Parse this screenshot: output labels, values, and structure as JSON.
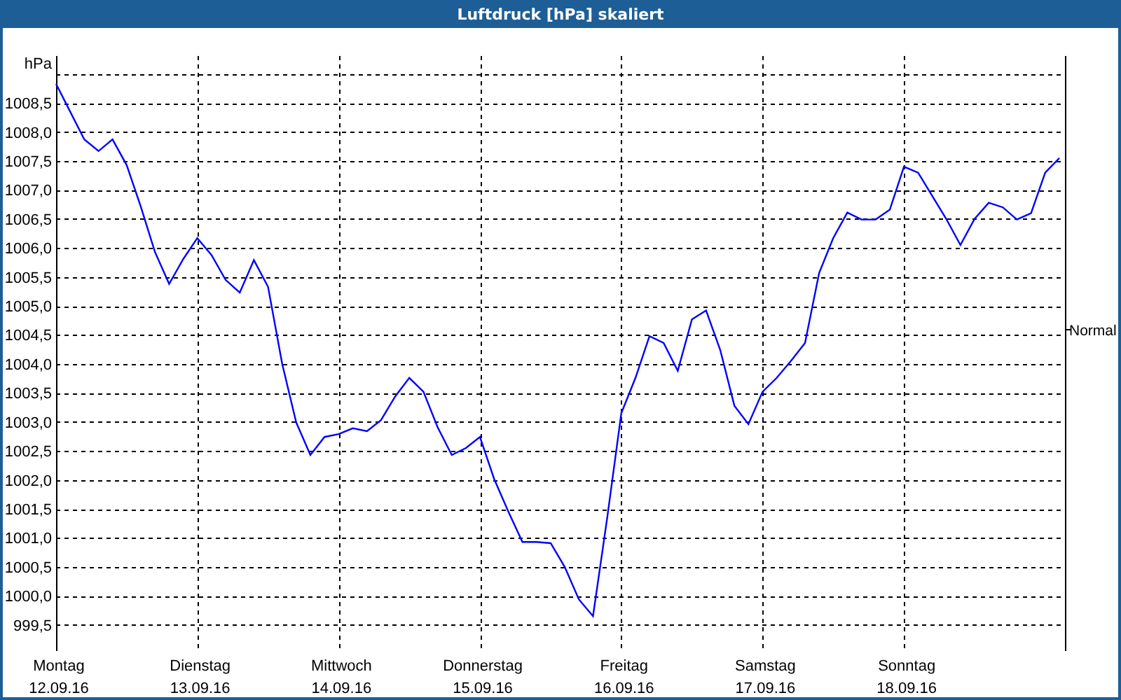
{
  "window": {
    "title": "Luftdruck [hPa] skaliert"
  },
  "chart": {
    "x_dates": [
      "12.09.16",
      "13.09.16",
      "14.09.16",
      "15.09.16",
      "16.09.16",
      "17.09.16",
      "18.09.16"
    ],
    "chart_data": {
      "type": "line",
      "grid": true,
      "ylabel": "hPa",
      "ylim": [
        999.05,
        1009.31
      ],
      "categories": [
        "Montag",
        null,
        null,
        null,
        null,
        null,
        null,
        null,
        null,
        null,
        "Dienstag",
        null,
        null,
        null,
        null,
        null,
        null,
        null,
        null,
        null,
        "Mittwoch",
        null,
        null,
        null,
        null,
        null,
        null,
        null,
        null,
        null,
        "Donnerstag",
        null,
        null,
        null,
        null,
        null,
        null,
        null,
        null,
        null,
        "Freitag",
        null,
        null,
        null,
        null,
        null,
        null,
        null,
        null,
        null,
        "Samstag",
        null,
        null,
        null,
        null,
        null,
        null,
        null,
        null,
        null,
        "Sonntag",
        null,
        null,
        null,
        null,
        null,
        null,
        null,
        null,
        null,
        null,
        null
      ],
      "yticks": [
        {
          "value": 999.5,
          "label": "999,5"
        },
        {
          "value": 1000,
          "label": "1000,0"
        },
        {
          "value": 1000.5,
          "label": "1000,5"
        },
        {
          "value": 1001,
          "label": "1001,0"
        },
        {
          "value": 1001.5,
          "label": "1001,5"
        },
        {
          "value": 1002,
          "label": "1002,0"
        },
        {
          "value": 1002.5,
          "label": "1002,5"
        },
        {
          "value": 1003,
          "label": "1003,0"
        },
        {
          "value": 1003.5,
          "label": "1003,5"
        },
        {
          "value": 1004,
          "label": "1004,0"
        },
        {
          "value": 1004.5,
          "label": "1004,5"
        },
        {
          "value": 1005,
          "label": "1005,0"
        },
        {
          "value": 1005.5,
          "label": "1005,5"
        },
        {
          "value": 1006,
          "label": "1006,0"
        },
        {
          "value": 1006.5,
          "label": "1006,5"
        },
        {
          "value": 1007,
          "label": "1007,0"
        },
        {
          "value": 1007.5,
          "label": "1007,5"
        },
        {
          "value": 1008,
          "label": "1008,0"
        },
        {
          "value": 1008.5,
          "label": "1008,5"
        }
      ],
      "series": [
        {
          "color": "#0000ff",
          "values": [
            1008.83,
            1008.35,
            1007.87,
            1007.67,
            1007.87,
            1007.43,
            1006.71,
            1005.93,
            1005.38,
            1005.81,
            1006.17,
            1005.88,
            1005.45,
            1005.23,
            1005.79,
            1005.33,
            1004.0,
            1002.99,
            1002.43,
            1002.74,
            1002.79,
            1002.89,
            1002.84,
            1003.03,
            1003.44,
            1003.76,
            1003.52,
            1002.91,
            1002.43,
            1002.55,
            1002.74,
            1002.02,
            1001.46,
            1000.93,
            1000.93,
            1000.91,
            1000.5,
            999.94,
            999.65,
            1001.34,
            1003.15,
            1003.76,
            1004.48,
            1004.36,
            1003.88,
            1004.77,
            1004.92,
            1004.24,
            1003.28,
            1002.96,
            1003.52,
            1003.76,
            1004.05,
            1004.36,
            1005.57,
            1006.17,
            1006.61,
            1006.49,
            1006.49,
            1006.66,
            1007.4,
            1007.3,
            1006.9,
            1006.5,
            1006.05,
            1006.5,
            1006.78,
            1006.7,
            1006.49,
            1006.6,
            1007.3,
            1007.55
          ]
        }
      ],
      "annotations": [
        "Normal"
      ]
    }
  }
}
